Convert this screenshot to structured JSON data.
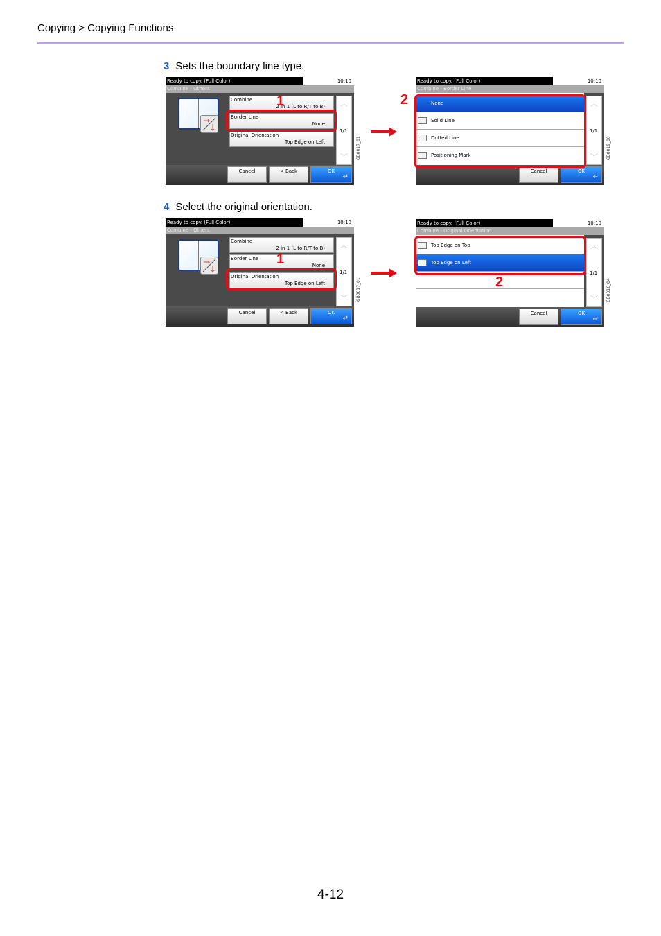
{
  "header": {
    "breadcrumb": "Copying > Copying Functions",
    "rule_color": "#b9a3ef"
  },
  "steps": [
    {
      "number": "3",
      "text": "Sets the boundary line type."
    },
    {
      "number": "4",
      "text": "Select the original orientation."
    }
  ],
  "screens": {
    "s3a": {
      "status": "Ready to copy. (Full Color)",
      "time": "10:10",
      "title": "Combine - Others",
      "rows": [
        {
          "label": "Combine",
          "value": "2 in 1 (L to R/T to B)"
        },
        {
          "label": "Border Line",
          "value": "None"
        },
        {
          "label": "Original Orientation",
          "value": "Top Edge on Left"
        }
      ],
      "pager": "1/1",
      "cancel": "Cancel",
      "back": "< Back",
      "ok": "OK",
      "callout": "1",
      "code": "GB0017_01"
    },
    "s3b": {
      "status": "Ready to copy. (Full Color)",
      "time": "10:10",
      "title": "Combine - Border Line",
      "options": [
        "None",
        "Solid Line",
        "Dotted Line",
        "Positioning Mark"
      ],
      "selected": "None",
      "pager": "1/1",
      "cancel": "Cancel",
      "ok": "OK",
      "callout": "2",
      "code": "GB0019_00"
    },
    "s4a": {
      "status": "Ready to copy. (Full Color)",
      "time": "10:10",
      "title": "Combine - Others",
      "rows": [
        {
          "label": "Combine",
          "value": "2 in 1 (L to R/T to B)"
        },
        {
          "label": "Border Line",
          "value": "None"
        },
        {
          "label": "Original Orientation",
          "value": "Top Edge on Left"
        }
      ],
      "pager": "1/1",
      "cancel": "Cancel",
      "back": "< Back",
      "ok": "OK",
      "callout": "1",
      "code": "GB0017_01"
    },
    "s4b": {
      "status": "Ready to copy. (Full Color)",
      "time": "10:10",
      "title": "Combine - Original Orientation",
      "options": [
        "Top Edge on Top",
        "Top Edge on Left"
      ],
      "selected": "Top Edge on Left",
      "pager": "1/1",
      "cancel": "Cancel",
      "ok": "OK",
      "callout": "2",
      "code": "GB0016_04"
    }
  },
  "page_number": "4-12"
}
